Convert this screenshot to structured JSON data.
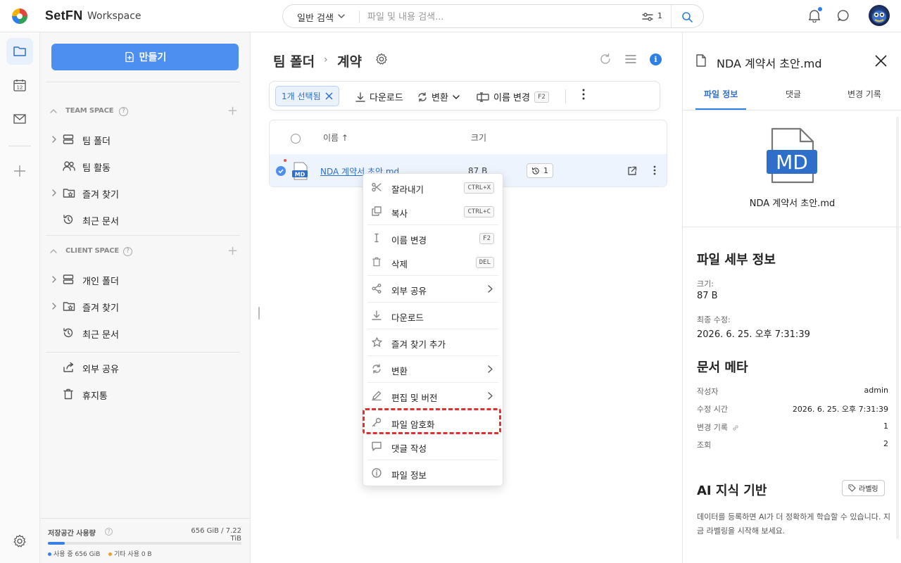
{
  "header": {
    "brand": "SetFN",
    "workspace": "Workspace",
    "search_mode": "일반 검색",
    "search_placeholder": "파일 및 내용 검색...",
    "filter_count": "1"
  },
  "sidebar": {
    "create_label": "만들기",
    "team_space_title": "TEAM SPACE",
    "team_items": [
      {
        "label": "팀 폴더",
        "icon": "server-icon"
      },
      {
        "label": "팀 활동",
        "icon": "people-icon"
      },
      {
        "label": "즐겨 찾기",
        "icon": "star-folder-icon"
      },
      {
        "label": "최근 문서",
        "icon": "history-icon"
      }
    ],
    "client_space_title": "CLIENT SPACE",
    "client_items": [
      {
        "label": "개인 폴더",
        "icon": "server-icon"
      },
      {
        "label": "즐겨 찾기",
        "icon": "star-folder-icon"
      },
      {
        "label": "최근 문서",
        "icon": "history-icon"
      }
    ],
    "extra_items": [
      {
        "label": "외부 공유",
        "icon": "share-icon"
      },
      {
        "label": "휴지통",
        "icon": "trash-icon"
      }
    ],
    "storage_label": "저장공간 사용량",
    "storage_value": "656 GiB / 7.22 TiB",
    "storage_fraction": 0.089,
    "storage_used": "사용 중 656 GiB",
    "storage_other": "기타 사용 0 B",
    "colors": {
      "used": "#3b7fe3",
      "other": "#f0a030"
    }
  },
  "main": {
    "crumb_root": "팀 폴더",
    "crumb_sep": "›",
    "crumb_current": "계약",
    "toolbar": {
      "selected": "1개 선택됨",
      "download": "다운로드",
      "convert": "변환",
      "rename": "이름 변경",
      "rename_key": "F2"
    },
    "table": {
      "col_name": "이름 ↑",
      "col_size": "크기",
      "rows": [
        {
          "name": "NDA 계약서 초안.md",
          "size": "87 B",
          "versions": "1",
          "type_badge": "MD"
        }
      ]
    }
  },
  "context_menu": {
    "items": [
      {
        "label": "잘라내기",
        "key": "CTRL+X",
        "icon": "scissors-icon"
      },
      {
        "label": "복사",
        "key": "CTRL+C",
        "icon": "copy-icon"
      },
      {
        "label": "이름 변경",
        "key": "F2",
        "icon": "text-cursor-icon"
      },
      {
        "label": "삭제",
        "key": "DEL",
        "icon": "trash-icon"
      },
      {
        "label": "외부 공유",
        "key": "",
        "icon": "share-nodes-icon",
        "submenu": true
      },
      {
        "label": "다운로드",
        "key": "",
        "icon": "download-icon"
      },
      {
        "label": "즐겨 찾기 추가",
        "key": "",
        "icon": "star-icon"
      },
      {
        "label": "변환",
        "key": "",
        "icon": "convert-icon",
        "submenu": true
      },
      {
        "label": "편집 및 버전",
        "key": "",
        "icon": "pencil-icon",
        "submenu": true
      },
      {
        "label": "파일 암호화",
        "key": "",
        "icon": "key-icon"
      },
      {
        "label": "댓글 작성",
        "key": "",
        "icon": "comment-icon"
      },
      {
        "label": "파일 정보",
        "key": "",
        "icon": "info-icon"
      }
    ]
  },
  "panel": {
    "title": "NDA 계약서 초안.md",
    "tabs": [
      "파일 정보",
      "댓글",
      "변경 기록"
    ],
    "big_icon_label": "MD",
    "filename": "NDA 계약서 초안.md",
    "details_title": "파일 세부 정보",
    "size_label": "크기:",
    "size_value": "87 B",
    "modified_label": "최종 수정:",
    "modified_value": "2026. 6. 25. 오후 7:31:39",
    "meta_title": "문서 메타",
    "meta": [
      {
        "k": "작성자",
        "v": "admin"
      },
      {
        "k": "수정 시간",
        "v": "2026. 6. 25. 오후 7:31:39"
      },
      {
        "k": "변경 기록",
        "v": "1"
      },
      {
        "k": "조회",
        "v": "2"
      }
    ],
    "ai_title": "AI 지식 기반",
    "ai_button": "라벨링",
    "ai_desc": "데이터를 등록하면 AI가 더 정확하게 학습할 수 있습니다. 지금 라벨링을 시작해 보세요."
  },
  "colors": {
    "accent": "#2f7fe8",
    "primary_button": "#4d8ff1",
    "highlight": "#e03030"
  }
}
